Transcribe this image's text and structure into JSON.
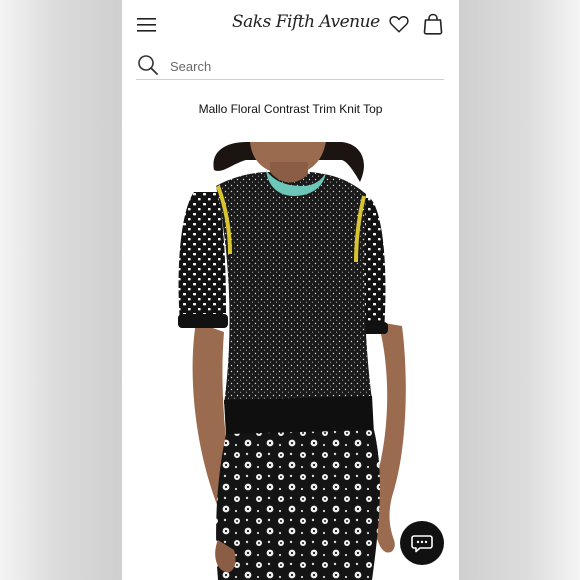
{
  "header": {
    "logo_text": "Saks Fifth Avenue",
    "menu_icon": "hamburger-menu-icon",
    "wishlist_icon": "heart-icon",
    "bag_icon": "shopping-bag-icon"
  },
  "search": {
    "placeholder": "Search",
    "icon": "search-icon"
  },
  "product": {
    "title": "Mallo Floral Contrast Trim Knit Top",
    "colors": {
      "knit": "#1a1a1a",
      "collar": "#6cc7b8",
      "shoulder_trim": "#d7c431",
      "skin": "#9a6b4f"
    }
  },
  "chat": {
    "icon": "chat-bubble-icon",
    "color": "#111111"
  }
}
